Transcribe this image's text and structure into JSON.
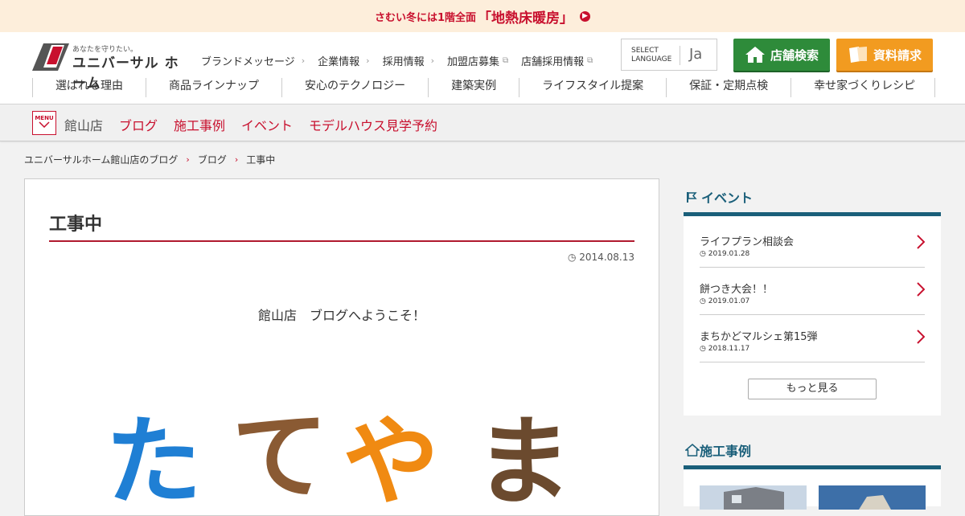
{
  "banner": {
    "prefix": "さむい冬には1階全面",
    "highlight": "「地熱床暖房」"
  },
  "header": {
    "logo_tagline": "あなたを守りたい。",
    "logo_name": "ユニバーサル ホーム",
    "util_links": [
      "ブランドメッセージ",
      "企業情報",
      "採用情報",
      "加盟店募集",
      "店舗採用情報"
    ],
    "lang_label_1": "SELECT",
    "lang_label_2": "LANGUAGE",
    "lang_value": "Ja",
    "store_search": "店舗検索",
    "doc_request": "資料請求",
    "global_nav": [
      "選ばれる理由",
      "商品ラインナップ",
      "安心のテクノロジー",
      "建築実例",
      "ライフスタイル提案",
      "保証・定期点検",
      "幸せ家づくりレシピ"
    ]
  },
  "subnav": {
    "menu_label": "MENU",
    "store_name": "館山店",
    "links": [
      "ブログ",
      "施工事例",
      "イベント",
      "モデルハウス見学予約"
    ]
  },
  "breadcrumb": [
    "ユニバーサルホーム館山店のブログ",
    "ブログ",
    "工事中"
  ],
  "article": {
    "title": "工事中",
    "date": "2014.08.13",
    "welcome": "館山店　ブログへようこそ！",
    "hero_text": [
      "た",
      "て",
      "や",
      "ま"
    ]
  },
  "sidebar": {
    "events_title": "イベント",
    "events": [
      {
        "title": "ライフプラン相談会",
        "date": "2019.01.28"
      },
      {
        "title": "餅つき大会！！",
        "date": "2019.01.07"
      },
      {
        "title": "まちかどマルシェ第15弾",
        "date": "2018.11.17"
      }
    ],
    "more_label": "もっと見る",
    "cases_title": "施工事例"
  },
  "colors": {
    "accent_red": "#c8102e",
    "teal": "#1a5f7a",
    "green": "#2e8b3a",
    "orange": "#f29b20"
  }
}
